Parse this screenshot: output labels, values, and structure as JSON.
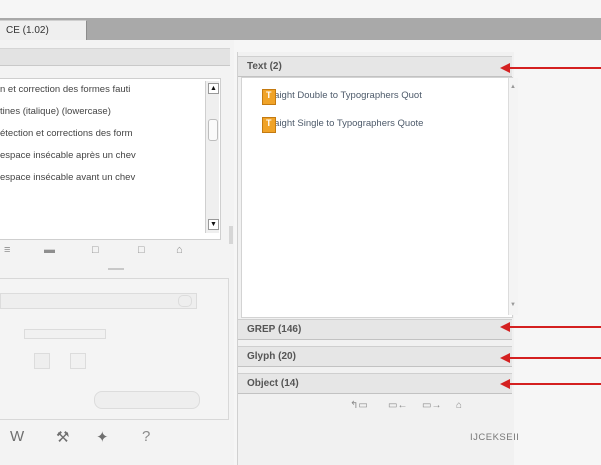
{
  "tab": {
    "label": "CE (1.02)"
  },
  "left": {
    "query_rows": [
      "n et correction des formes fauti",
      "tines (italique) (lowercase)",
      "étection et corrections des form",
      "espace insécable après un chev",
      "espace insécable avant un chev"
    ],
    "toolbar_icons": [
      "≡",
      "▬",
      "□",
      "□",
      "⌂"
    ],
    "bottom_icons": [
      "W",
      "⚒",
      "✦",
      "?"
    ]
  },
  "right": {
    "sections": {
      "text": "Text (2)",
      "grep": "GREP (146)",
      "glyph": "Glyph (20)",
      "object": "Object (14)"
    },
    "text_items": [
      "Straight Double to Typographers Quot",
      "Straight Single to Typographers Quote"
    ],
    "item_icon_letter": "T",
    "toolbar_icons": [
      "↰▭",
      "▭←",
      "▭→",
      "⌂"
    ],
    "bottom_label": "IJCEKSEII"
  },
  "colors": {
    "annotation_arrow": "#d42020",
    "item_icon": "#f0a328"
  }
}
